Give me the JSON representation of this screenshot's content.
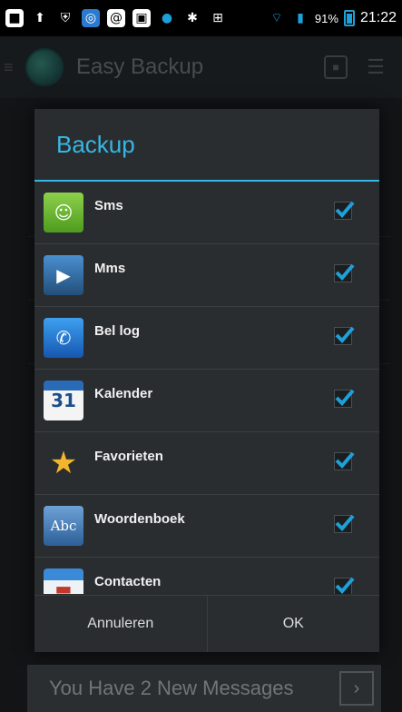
{
  "status_bar": {
    "battery_percent": "91%",
    "time": "21:22",
    "icons": [
      "notification-icon",
      "upload-icon",
      "shield-icon",
      "app-icon",
      "at-icon",
      "image-icon",
      "dot-icon",
      "bluetooth-icon",
      "nfc-icon",
      "wifi-icon",
      "signal-icon"
    ]
  },
  "app_bar": {
    "title": "Easy Backup"
  },
  "dialog": {
    "title": "Backup",
    "items": [
      {
        "label": "Sms",
        "icon": "sms-icon",
        "checked": true
      },
      {
        "label": "Mms",
        "icon": "mms-icon",
        "checked": true
      },
      {
        "label": "Bel log",
        "icon": "call-log-icon",
        "checked": true
      },
      {
        "label": "Kalender",
        "icon": "calendar-icon",
        "checked": true
      },
      {
        "label": "Favorieten",
        "icon": "favorites-icon",
        "checked": true
      },
      {
        "label": "Woordenboek",
        "icon": "dictionary-icon",
        "checked": true
      },
      {
        "label": "Contacten",
        "icon": "contacts-icon",
        "checked": true
      }
    ],
    "cancel_label": "Annuleren",
    "ok_label": "OK"
  },
  "banner": {
    "text": "You Have 2 New Messages"
  },
  "colors": {
    "accent": "#33b5e5",
    "check": "#1ea0d8"
  }
}
